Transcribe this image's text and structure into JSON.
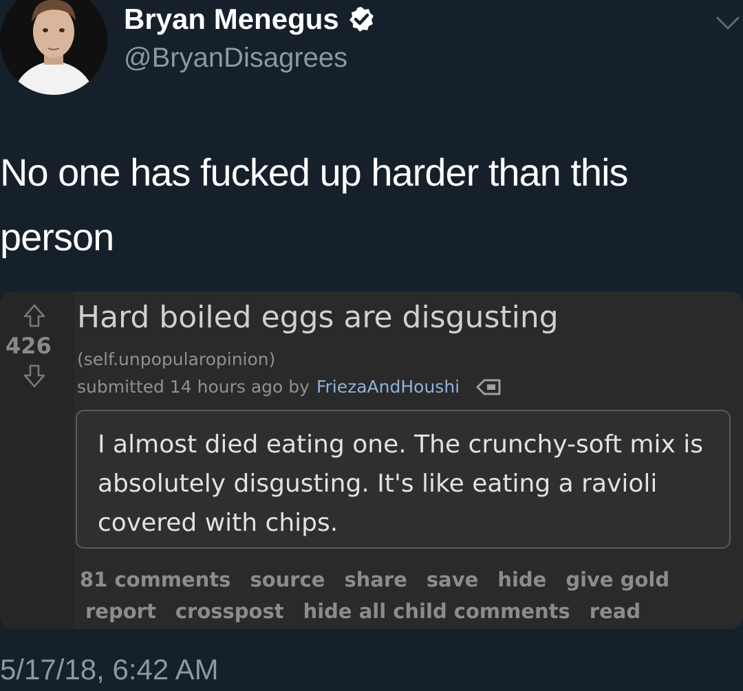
{
  "user": {
    "display_name": "Bryan Menegus",
    "handle": "@BryanDisagrees"
  },
  "tweet": {
    "text": "No one has fucked up harder than this person",
    "timestamp": "5/17/18, 6:42 AM"
  },
  "embed": {
    "score": "426",
    "title": "Hard boiled eggs are disgusting",
    "domain": "(self.unpopularopinion)",
    "tagline_prefix": "submitted 14 hours ago by",
    "author": "FriezaAndHoushi",
    "selftext": "I almost died eating one. The crunchy-soft mix is absolutely disgusting. It's like eating a ravioli covered with chips.",
    "buttons_row1": [
      "81 comments",
      "source",
      "share",
      "save",
      "hide",
      "give gold"
    ],
    "buttons_row2": [
      "report",
      "crosspost",
      "hide all child comments",
      "read"
    ]
  },
  "colors": {
    "background": "#15202b",
    "embed_background": "#2a2a2a",
    "author_link": "#8fb3d9",
    "muted_text": "#8b98a5"
  },
  "icons": [
    "verified-badge-icon",
    "chevron-down-icon",
    "upvote-arrow-icon",
    "downvote-arrow-icon",
    "tag-icon"
  ]
}
